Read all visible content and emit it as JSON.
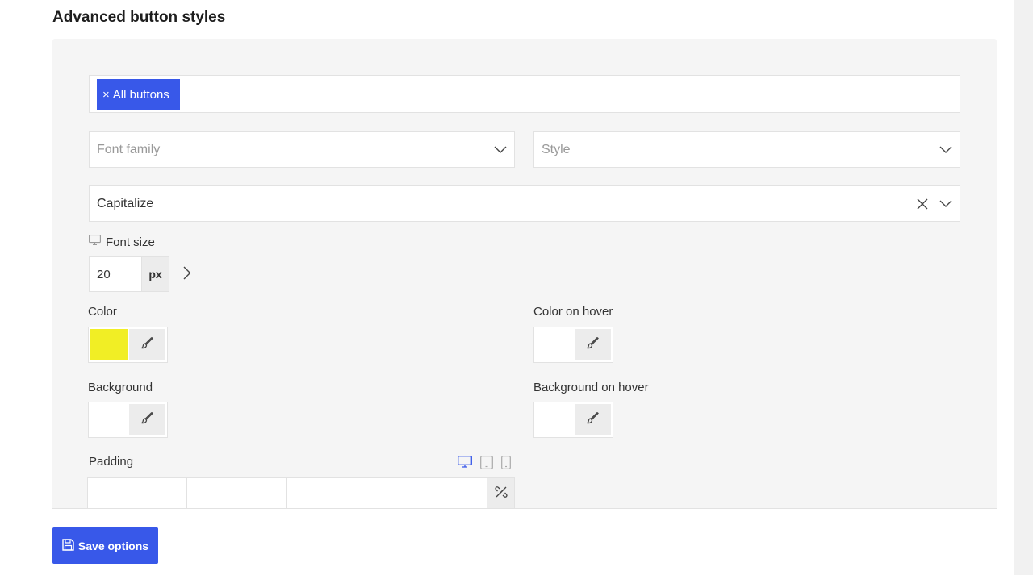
{
  "page_title": "Advanced button styles",
  "tags": {
    "selected": [
      {
        "label": "All buttons",
        "remove_icon": "×"
      }
    ]
  },
  "selects": {
    "font_family": {
      "placeholder": "Font family",
      "icon": "chevron-down-icon"
    },
    "style": {
      "placeholder": "Style",
      "icon": "chevron-down-icon"
    },
    "text_transform": {
      "value": "Capitalize",
      "clear_icon": "close-icon",
      "icon": "chevron-down-icon"
    }
  },
  "font_size": {
    "label": "Font size",
    "value": "20",
    "unit": "px",
    "device_icon": "desktop-icon",
    "next_icon": "chevron-right-icon"
  },
  "colors": {
    "color": {
      "label": "Color",
      "value": "#f1ee25"
    },
    "color_hover": {
      "label": "Color on hover",
      "value": ""
    },
    "background": {
      "label": "Background",
      "value": ""
    },
    "background_hover": {
      "label": "Background on hover",
      "value": ""
    }
  },
  "padding": {
    "label": "Padding",
    "devices": [
      "desktop-icon",
      "tablet-icon",
      "mobile-icon"
    ],
    "active_device": "desktop",
    "values": [
      "",
      "",
      "",
      ""
    ],
    "link_icon": "unlink-icon"
  },
  "save_button": {
    "label": "Save options",
    "icon": "save-icon"
  },
  "accent_color": "#3858e9"
}
